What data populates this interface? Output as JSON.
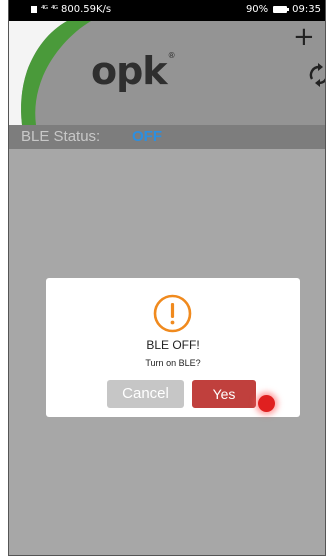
{
  "status_bar": {
    "network_speed": "800.59K/s",
    "battery_percent": "90%",
    "time": "09:35",
    "signal_1": "⁴ᴳ",
    "signal_2": "⁴ᴳ"
  },
  "header": {
    "logo_text": "opk",
    "logo_mark": "®",
    "add_icon": "plus-icon",
    "refresh_icon": "refresh-icon",
    "accent_color": "#3a8a3a"
  },
  "ble": {
    "label": "BLE Status:",
    "value": "OFF",
    "value_color": "#2c8fe0"
  },
  "dialog": {
    "icon": "alert-circle-icon",
    "icon_color": "#f08a1e",
    "title": "BLE OFF!",
    "message": "Turn on BLE?",
    "cancel_label": "Cancel",
    "yes_label": "Yes"
  }
}
